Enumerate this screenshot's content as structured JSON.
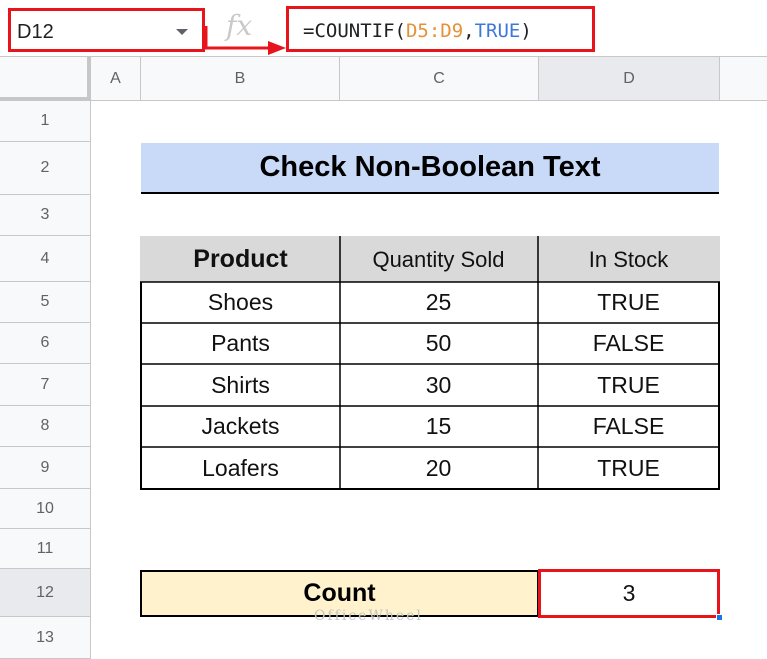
{
  "formula_bar": {
    "cell_ref": "D12",
    "fx_label": "fx",
    "formula_prefix": "=COUNTIF(",
    "formula_range": "D5:D9",
    "formula_sep": ",",
    "formula_arg": "TRUE",
    "formula_suffix": ")"
  },
  "columns": [
    "A",
    "B",
    "C",
    "D"
  ],
  "rows": [
    "1",
    "2",
    "3",
    "4",
    "5",
    "6",
    "7",
    "8",
    "9",
    "10",
    "11",
    "12",
    "13"
  ],
  "title": "Check Non-Boolean Text",
  "table": {
    "headers": [
      "Product",
      "Quantity Sold",
      "In Stock"
    ],
    "rows": [
      [
        "Shoes",
        "25",
        "TRUE"
      ],
      [
        "Pants",
        "50",
        "FALSE"
      ],
      [
        "Shirts",
        "30",
        "TRUE"
      ],
      [
        "Jackets",
        "15",
        "FALSE"
      ],
      [
        "Loafers",
        "20",
        "TRUE"
      ]
    ]
  },
  "count": {
    "label": "Count",
    "value": "3"
  },
  "watermark": "OfficeWheel",
  "colors": {
    "selection_red": "#e8141b",
    "title_bg": "#c9daf8",
    "header_bg": "#d9d9d9",
    "count_bg": "#fff2cc"
  }
}
